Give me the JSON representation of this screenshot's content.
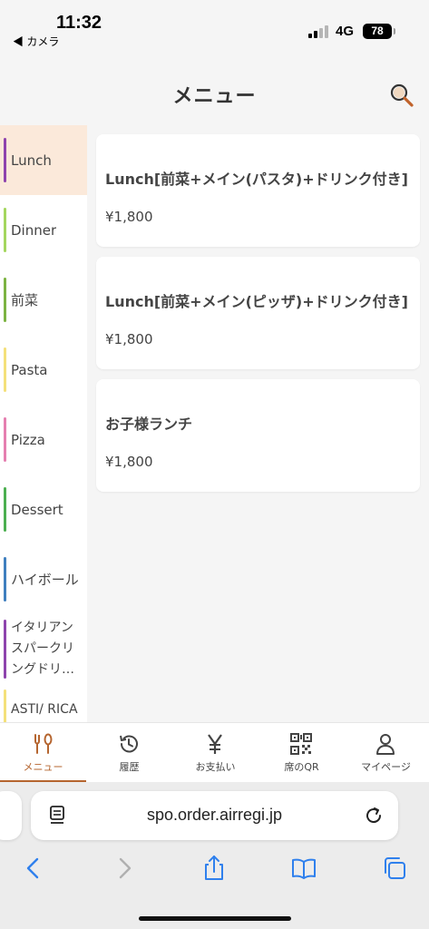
{
  "status": {
    "time": "11:32",
    "back_app": "◀ カメラ",
    "network": "4G",
    "battery": "78"
  },
  "header": {
    "title": "メニュー",
    "search_icon": "search-icon"
  },
  "sidebar": {
    "items": [
      {
        "label": "Lunch",
        "color": "#8e44ad",
        "active": true
      },
      {
        "label": "Dinner",
        "color": "#a4d65e"
      },
      {
        "label": "前菜",
        "color": "#7cb342"
      },
      {
        "label": "Pasta",
        "color": "#f4e07a"
      },
      {
        "label": "Pizza",
        "color": "#e57fb0"
      },
      {
        "label": "Dessert",
        "color": "#4caf50"
      },
      {
        "label": "ハイボール",
        "color": "#3f7fbf"
      },
      {
        "label": "イタリアンスパークリングドリ…",
        "color": "#8e44ad"
      },
      {
        "label": "ASTI/ RICARD/ MARG",
        "color": "#f4e07a"
      }
    ]
  },
  "menu": {
    "items": [
      {
        "name": "Lunch[前菜+メイン(パスタ)+ドリンク付き]",
        "price": "¥1,800"
      },
      {
        "name": "Lunch[前菜+メイン(ピッザ)+ドリンク付き]",
        "price": "¥1,800"
      },
      {
        "name": "お子様ランチ",
        "price": "¥1,800"
      }
    ]
  },
  "tabbar": {
    "tabs": [
      {
        "label": "メニュー",
        "icon": "fork-knife-icon",
        "active": true
      },
      {
        "label": "履歴",
        "icon": "history-icon"
      },
      {
        "label": "お支払い",
        "icon": "yen-icon"
      },
      {
        "label": "席のQR",
        "icon": "qr-code-icon"
      },
      {
        "label": "マイページ",
        "icon": "person-icon"
      }
    ]
  },
  "browser": {
    "url": "spo.order.airregi.jp"
  },
  "colors": {
    "accent": "#b5652f",
    "active_bg": "#fbe9da"
  }
}
